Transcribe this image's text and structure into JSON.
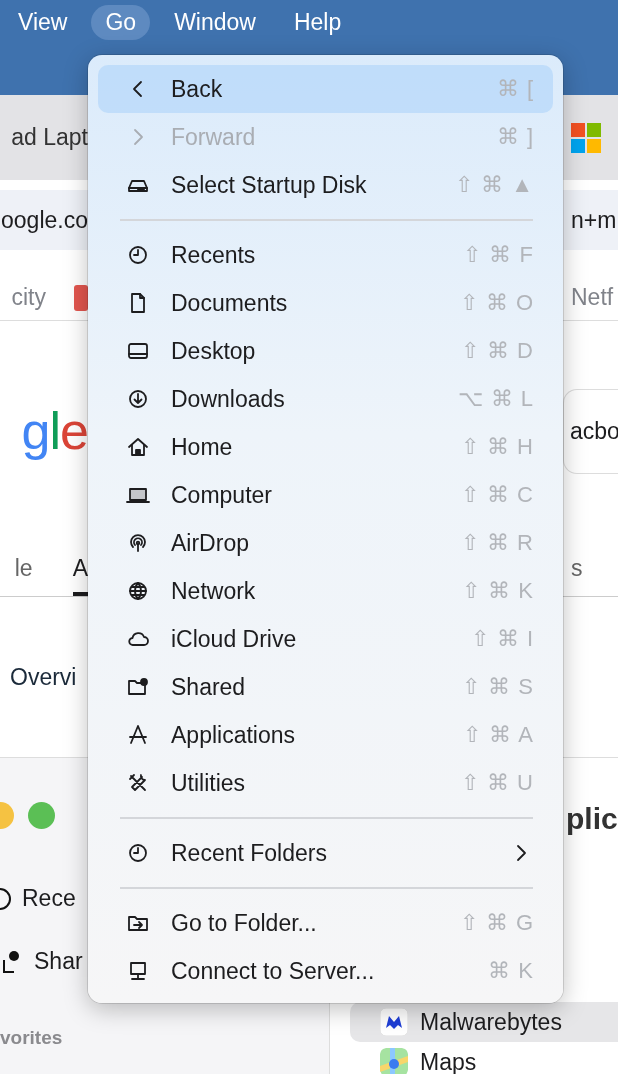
{
  "menu_bar": [
    {
      "label": "View",
      "selected": false
    },
    {
      "label": "Go",
      "selected": true
    },
    {
      "label": "Window",
      "selected": false
    },
    {
      "label": "Help",
      "selected": false
    }
  ],
  "browser": {
    "tab_left": "ad Lapt",
    "address_left": "oogle.co",
    "address_right": "n+m",
    "bookmark_left": "city",
    "bookmark_right": "Netf",
    "logo": "gle",
    "search_value": "acbo",
    "result_tabs": [
      {
        "label": "le",
        "selected": false
      },
      {
        "label": "A",
        "selected": true
      },
      {
        "label": "s",
        "selected": false
      }
    ],
    "overview": "Overvi"
  },
  "finder": {
    "sidebar": [
      {
        "label": "Rece"
      },
      {
        "label": "Shar"
      }
    ],
    "section": "vorites",
    "title": "plic",
    "files": [
      {
        "label": "Malwarebytes",
        "selected": true
      },
      {
        "label": "Maps",
        "selected": false
      }
    ]
  },
  "go_menu": [
    {
      "kind": "item",
      "label": "Back",
      "shortcut": "⌘ [",
      "disabled": false,
      "highlighted": true
    },
    {
      "kind": "item",
      "label": "Forward",
      "shortcut": "⌘ ]",
      "disabled": true,
      "highlighted": false
    },
    {
      "kind": "item",
      "label": "Select Startup Disk",
      "shortcut": "⇧ ⌘ ▲",
      "disabled": false,
      "highlighted": false
    },
    {
      "kind": "separator"
    },
    {
      "kind": "item",
      "label": "Recents",
      "shortcut": "⇧ ⌘ F",
      "disabled": false,
      "highlighted": false
    },
    {
      "kind": "item",
      "label": "Documents",
      "shortcut": "⇧ ⌘ O",
      "disabled": false,
      "highlighted": false
    },
    {
      "kind": "item",
      "label": "Desktop",
      "shortcut": "⇧ ⌘ D",
      "disabled": false,
      "highlighted": false
    },
    {
      "kind": "item",
      "label": "Downloads",
      "shortcut": "⌥ ⌘ L",
      "disabled": false,
      "highlighted": false
    },
    {
      "kind": "item",
      "label": "Home",
      "shortcut": "⇧ ⌘ H",
      "disabled": false,
      "highlighted": false
    },
    {
      "kind": "item",
      "label": "Computer",
      "shortcut": "⇧ ⌘ C",
      "disabled": false,
      "highlighted": false
    },
    {
      "kind": "item",
      "label": "AirDrop",
      "shortcut": "⇧ ⌘ R",
      "disabled": false,
      "highlighted": false
    },
    {
      "kind": "item",
      "label": "Network",
      "shortcut": "⇧ ⌘ K",
      "disabled": false,
      "highlighted": false
    },
    {
      "kind": "item",
      "label": "iCloud Drive",
      "shortcut": "⇧ ⌘ I",
      "disabled": false,
      "highlighted": false
    },
    {
      "kind": "item",
      "label": "Shared",
      "shortcut": "⇧ ⌘ S",
      "disabled": false,
      "highlighted": false
    },
    {
      "kind": "item",
      "label": "Applications",
      "shortcut": "⇧ ⌘ A",
      "disabled": false,
      "highlighted": false
    },
    {
      "kind": "item",
      "label": "Utilities",
      "shortcut": "⇧ ⌘ U",
      "disabled": false,
      "highlighted": false
    },
    {
      "kind": "separator"
    },
    {
      "kind": "submenu",
      "label": "Recent Folders",
      "disabled": false,
      "highlighted": false
    },
    {
      "kind": "separator"
    },
    {
      "kind": "item",
      "label": "Go to Folder...",
      "shortcut": "⇧ ⌘ G",
      "disabled": false,
      "highlighted": false
    },
    {
      "kind": "item",
      "label": "Connect to Server...",
      "shortcut": "⌘ K",
      "disabled": false,
      "highlighted": false
    }
  ]
}
